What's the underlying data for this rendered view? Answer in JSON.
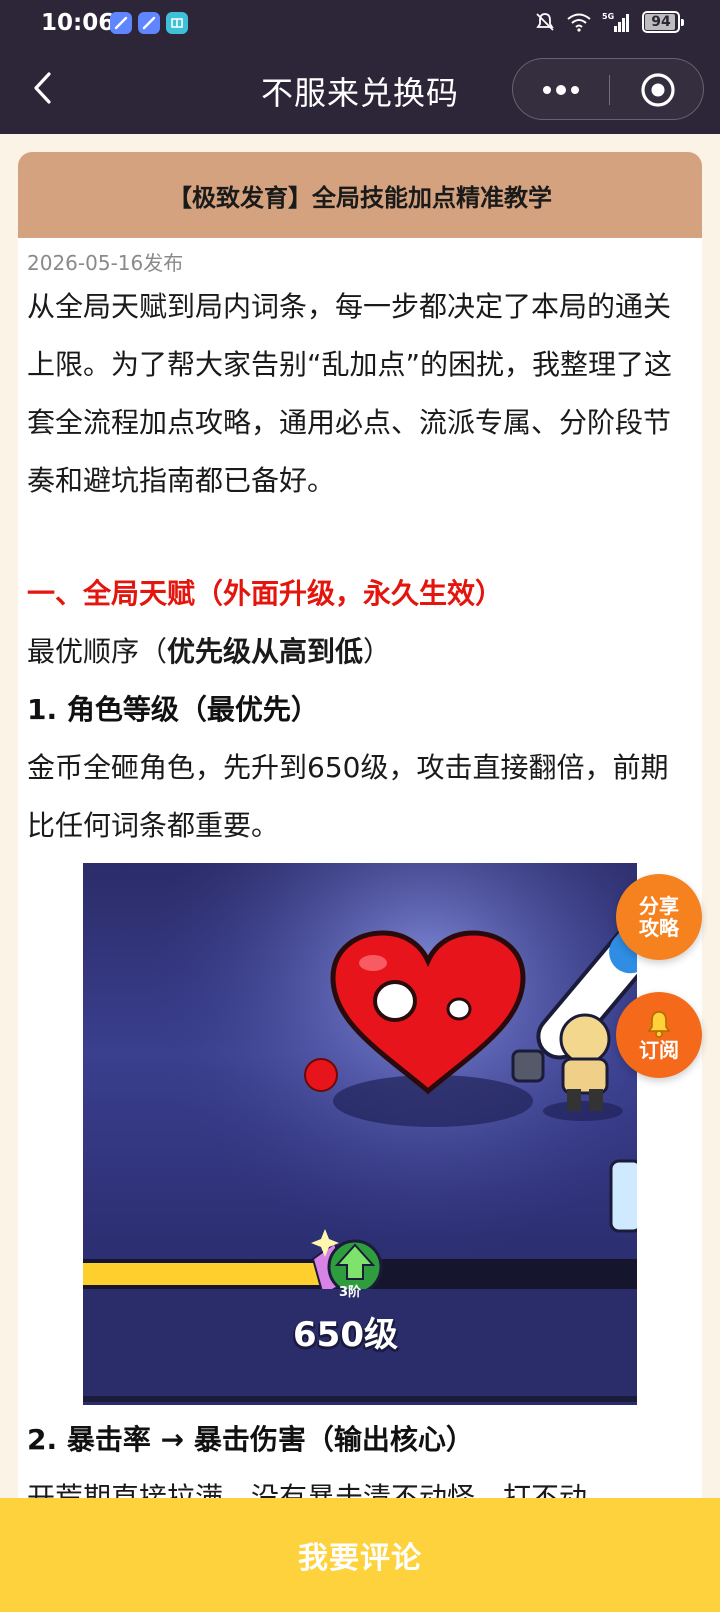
{
  "status": {
    "time": "10:06",
    "battery": "94",
    "signal": "5G"
  },
  "nav": {
    "title": "不服来兑换码"
  },
  "article": {
    "title": "【极致发育】全局技能加点精准教学",
    "date": "2026-05-16发布",
    "intro": "从全局天赋到局内词条，每一步都决定了本局的通关上限。为了帮大家告别“乱加点”的困扰，我整理了这套全流程加点攻略，通用必点、流派专属、分阶段节奏和避坑指南都已备好。",
    "section1_title": "一、全局天赋（外面升级，永久生效）",
    "order_prefix": "最优顺序（",
    "order_bold": "优先级从高到低",
    "order_suffix": "）",
    "item1_title": "1. 角色等级（最优先）",
    "item1_text": "金币全砸角色，先升到650级，攻击直接翻倍，前期比任何词条都重要。",
    "image_level": "650级",
    "image_tier": "3阶",
    "item2_title": "2. 暴击率 → 暴击伤害（输出核心）",
    "item2_text_partial": "开荒期直接拉满，没有暴击清不动怪，打不动"
  },
  "fabs": {
    "share_line1": "分享",
    "share_line2": "攻略",
    "subscribe": "订阅"
  },
  "bottom": {
    "comment": "我要评论"
  },
  "colors": {
    "header_bg": "#2d2638",
    "card_title_bg": "#d4a27e",
    "section_red": "#e3150c",
    "fab_orange": "#f5821f",
    "bottom_yellow": "#fdd23d"
  }
}
